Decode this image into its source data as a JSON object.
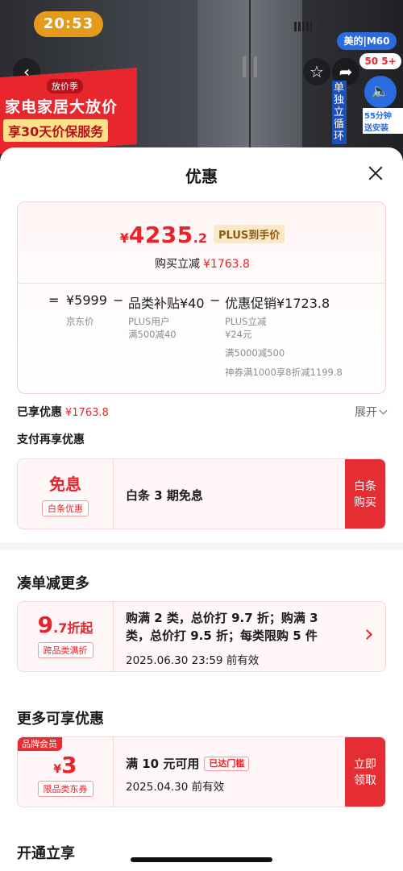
{
  "background": {
    "time": "20:53",
    "brand_tag": "美的|M60",
    "promo_small": "放价季",
    "promo_title": "家电家居大放价",
    "promo_sub": "享30天价保服务",
    "side_badge": "50 5+",
    "install_text": "55分钟\n送安装",
    "vertical_text": "单独立循环"
  },
  "sheet": {
    "title": "优惠"
  },
  "price_card": {
    "currency": "¥",
    "price_int": "4235",
    "price_dec": ".2",
    "plus_tag": "PLUS到手价",
    "instant_label": "购买立减",
    "instant_value": "¥1763.8",
    "breakdown": {
      "eq": "=",
      "jd_price": "¥5999",
      "jd_label": "京东价",
      "minus1": "−",
      "category_subsidy": "品类补贴¥40",
      "category_sub_line1": "PLUS用户",
      "category_sub_line2": "满500减40",
      "minus2": "−",
      "promo": "优惠促销¥1723.8",
      "promo_line1": "PLUS立减",
      "promo_line2": "¥24元",
      "promo_line3": "满5000减500",
      "promo_line4": "神券满1000享8折减1199.8"
    }
  },
  "savings": {
    "label": "已享优惠",
    "value": "¥1763.8",
    "expand": "展开"
  },
  "pay_section": {
    "title": "支付再享优惠",
    "left_big": "免息",
    "left_tag": "白条优惠",
    "text": "白条 3 期免息",
    "button_line1": "白条",
    "button_line2": "购买"
  },
  "bundle_section": {
    "title": "凑单减更多",
    "discount_int": "9",
    "discount_rest": ".7折起",
    "left_tag": "跨品类满折",
    "desc_line1": "购满 2 类，总价打 9.7 折；购满 3",
    "desc_line2": "类，总价打 9.5 折；每类限购 5 件",
    "deadline": "2025.06.30 23:59 前有效"
  },
  "more_section": {
    "title": "更多可享优惠",
    "member_tag": "品牌会员",
    "coupon_cur": "¥",
    "coupon_val": "3",
    "left_tag": "限品类东券",
    "cond": "满 10 元可用",
    "threshold_tag": "已达门槛",
    "deadline": "2025.04.30 前有效",
    "button_line1": "立即",
    "button_line2": "领取"
  },
  "open_section": {
    "title": "开通立享"
  },
  "colors": {
    "accent": "#e6242b",
    "button": "#e42e34",
    "card_bg": "#fff7f7",
    "plus_tag_bg": "#fbe9c6"
  }
}
